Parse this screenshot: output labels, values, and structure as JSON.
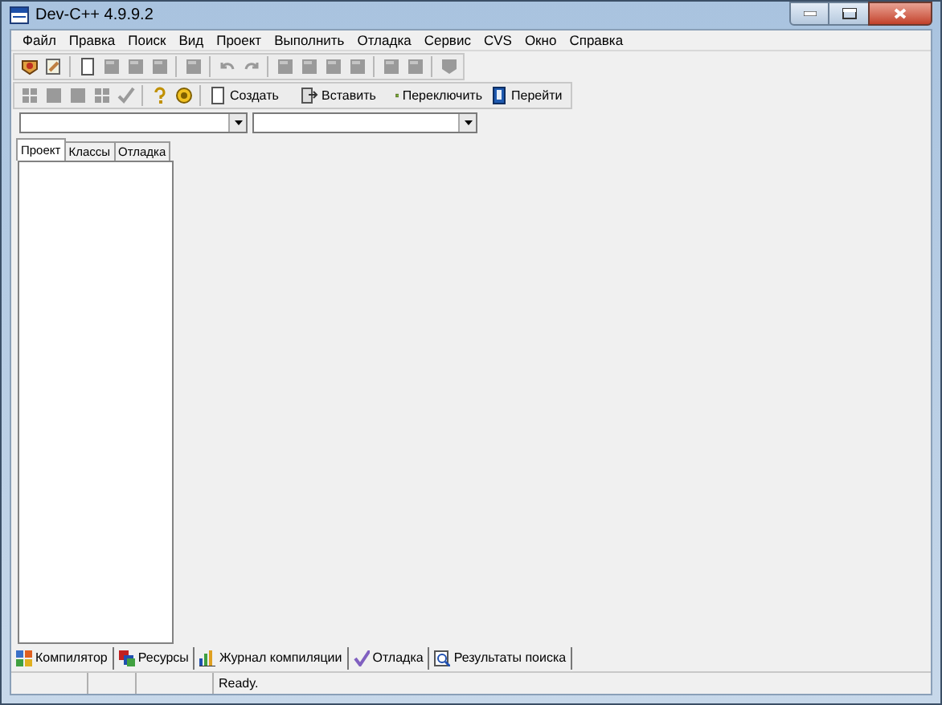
{
  "window": {
    "title": "Dev-C++ 4.9.9.2"
  },
  "menu": [
    "Файл",
    "Правка",
    "Поиск",
    "Вид",
    "Проект",
    "Выполнить",
    "Отладка",
    "Сервис",
    "CVS",
    "Окно",
    "Справка"
  ],
  "toolbar_buttons": [
    {
      "label": "Создать"
    },
    {
      "label": "Вставить"
    },
    {
      "label": "Переключить"
    },
    {
      "label": "Перейти"
    }
  ],
  "left_tabs": [
    {
      "label": "Проект",
      "selected": true
    },
    {
      "label": "Классы",
      "selected": false
    },
    {
      "label": "Отладка",
      "selected": false
    }
  ],
  "bottom_tabs": [
    {
      "label": "Компилятор"
    },
    {
      "label": "Ресурсы"
    },
    {
      "label": "Журнал компиляции"
    },
    {
      "label": "Отладка"
    },
    {
      "label": "Результаты поиска"
    }
  ],
  "status_bar": {
    "message": "Ready."
  }
}
